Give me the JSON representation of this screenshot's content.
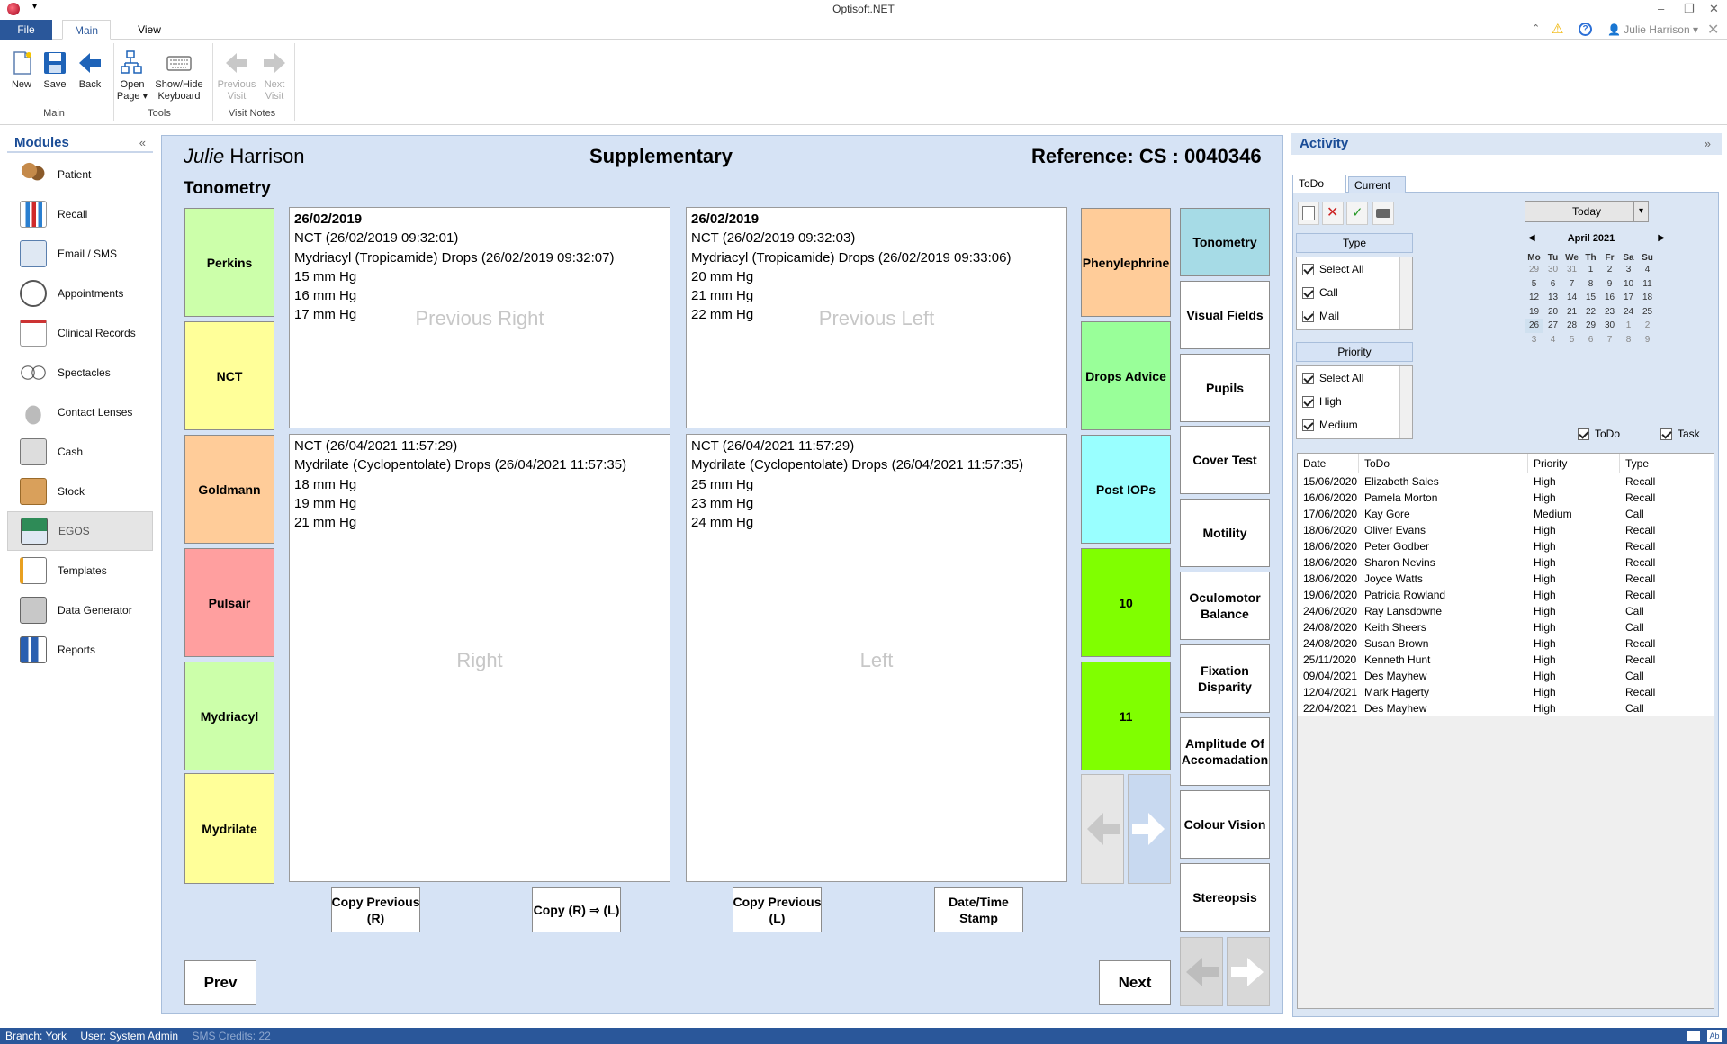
{
  "app": {
    "title": "Optisoft.NET",
    "user": "Julie Harrison"
  },
  "ribbon_tabs": [
    "File",
    "Main",
    "View"
  ],
  "ribbon": {
    "buttons": [
      {
        "label": "New",
        "label2": ""
      },
      {
        "label": "Save",
        "label2": ""
      },
      {
        "label": "Back",
        "label2": ""
      },
      {
        "label": "Open",
        "label2": "Page ▾"
      },
      {
        "label": "Show/Hide",
        "label2": "Keyboard"
      },
      {
        "label": "Previous",
        "label2": "Visit"
      },
      {
        "label": "Next",
        "label2": "Visit"
      }
    ],
    "groups": [
      "Main",
      "Tools",
      "Visit Notes"
    ]
  },
  "modules": {
    "title": "Modules",
    "collapse": "«",
    "items": [
      "Patient",
      "Recall",
      "Email / SMS",
      "Appointments",
      "Clinical Records",
      "Spectacles",
      "Contact Lenses",
      "Cash",
      "Stock",
      "EGOS",
      "Templates",
      "Data Generator",
      "Reports"
    ]
  },
  "header": {
    "first": "Julie",
    "last": "Harrison",
    "page": "Supplementary",
    "reference": "Reference: CS : 0040346"
  },
  "section": "Tonometry",
  "left_buttons": [
    "Perkins",
    "NCT",
    "Goldmann",
    "Pulsair",
    "Mydriacyl",
    "Mydrilate"
  ],
  "panels": {
    "prev_right": {
      "lines": [
        "26/02/2019",
        "NCT (26/02/2019 09:32:01)",
        "Mydriacyl (Tropicamide) Drops (26/02/2019 09:32:07)",
        "15 mm Hg",
        "16 mm Hg",
        "17 mm Hg"
      ],
      "watermark": "Previous Right"
    },
    "prev_left": {
      "lines": [
        "26/02/2019",
        "NCT (26/02/2019 09:32:03)",
        "Mydriacyl (Tropicamide) Drops (26/02/2019 09:33:06)",
        "20 mm Hg",
        "21 mm Hg",
        "22 mm Hg"
      ],
      "watermark": "Previous Left"
    },
    "right": {
      "lines": [
        "NCT (26/04/2021 11:57:29)",
        "Mydrilate (Cyclopentolate) Drops (26/04/2021 11:57:35)",
        "18 mm Hg",
        "19 mm Hg",
        "21 mm Hg"
      ],
      "watermark": "Right"
    },
    "left": {
      "lines": [
        "NCT (26/04/2021 11:57:29)",
        "Mydrilate (Cyclopentolate) Drops (26/04/2021 11:57:35)",
        "25 mm Hg",
        "23 mm Hg",
        "24 mm Hg"
      ],
      "watermark": "Left"
    }
  },
  "bottom_buttons": [
    "Copy Previous\n(R)",
    "Copy (R) ⇒ (L)",
    "Copy Previous\n(L)",
    "Date/Time\nStamp"
  ],
  "right_buttons": [
    "Phenylephrine",
    "Drops Advice",
    "Post IOPs",
    "10",
    "11"
  ],
  "nav_buttons": [
    "Tonometry",
    "Visual Fields",
    "Pupils",
    "Cover Test",
    "Motility",
    "Oculomotor Balance",
    "Fixation Disparity",
    "Amplitude Of Accomadation",
    "Colour Vision",
    "Stereopsis"
  ],
  "prev_label": "Prev",
  "next_label": "Next",
  "activity": {
    "title": "Activity",
    "collapse": "»",
    "tabs": [
      "ToDo",
      "Current"
    ],
    "today": "Today",
    "type_label": "Type",
    "priority_label": "Priority",
    "type_items": [
      "Select All",
      "Call",
      "Mail"
    ],
    "priority_items": [
      "Select All",
      "High",
      "Medium"
    ],
    "filter_todo": "ToDo",
    "filter_task": "Task",
    "calendar": {
      "month": "April 2021",
      "days": [
        "Mo",
        "Tu",
        "We",
        "Th",
        "Fr",
        "Sa",
        "Su"
      ],
      "weeks": [
        [
          "29",
          "30",
          "31",
          "1",
          "2",
          "3",
          "4"
        ],
        [
          "5",
          "6",
          "7",
          "8",
          "9",
          "10",
          "11"
        ],
        [
          "12",
          "13",
          "14",
          "15",
          "16",
          "17",
          "18"
        ],
        [
          "19",
          "20",
          "21",
          "22",
          "23",
          "24",
          "25"
        ],
        [
          "26",
          "27",
          "28",
          "29",
          "30",
          "1",
          "2"
        ],
        [
          "3",
          "4",
          "5",
          "6",
          "7",
          "8",
          "9"
        ]
      ]
    },
    "columns": [
      "Date",
      "ToDo",
      "Priority",
      "Type"
    ],
    "rows": [
      [
        "15/06/2020",
        "Elizabeth Sales",
        "High",
        "Recall"
      ],
      [
        "16/06/2020",
        "Pamela Morton",
        "High",
        "Recall"
      ],
      [
        "17/06/2020",
        "Kay Gore",
        "Medium",
        "Call"
      ],
      [
        "18/06/2020",
        "Oliver Evans",
        "High",
        "Recall"
      ],
      [
        "18/06/2020",
        "Peter Godber",
        "High",
        "Recall"
      ],
      [
        "18/06/2020",
        "Sharon Nevins",
        "High",
        "Recall"
      ],
      [
        "18/06/2020",
        "Joyce Watts",
        "High",
        "Recall"
      ],
      [
        "19/06/2020",
        "Patricia Rowland",
        "High",
        "Recall"
      ],
      [
        "24/06/2020",
        "Ray Lansdowne",
        "High",
        "Call"
      ],
      [
        "24/08/2020",
        "Keith Sheers",
        "High",
        "Call"
      ],
      [
        "24/08/2020",
        "Susan Brown",
        "High",
        "Recall"
      ],
      [
        "25/11/2020",
        "Kenneth Hunt",
        "High",
        "Recall"
      ],
      [
        "09/04/2021",
        "Des Mayhew",
        "High",
        "Call"
      ],
      [
        "12/04/2021",
        "Mark Hagerty",
        "High",
        "Recall"
      ],
      [
        "22/04/2021",
        "Des Mayhew",
        "High",
        "Call"
      ]
    ]
  },
  "status": {
    "branch": "Branch: York",
    "user": "User: System Admin",
    "sms": "SMS Credits: 22"
  },
  "colors": {
    "panel_bg": "#d6e3f5",
    "accent": "#2a579a",
    "perkins": "#ccffaa",
    "nct": "#ffff99",
    "goldmann": "#ffcc99",
    "pulsair": "#ff9999",
    "phenylephrine": "#ffcc99",
    "drops_advice": "#99ff99",
    "post_iops": "#99ffff",
    "green_bright": "#80ff00",
    "tonometry_active": "#a6dbe6"
  }
}
